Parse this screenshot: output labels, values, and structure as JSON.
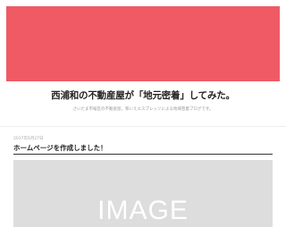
{
  "header": {
    "hero_color": "#ef5a65",
    "site_title": "西浦和の不動産屋が「地元密着」してみた。",
    "site_description": "さいたま市桜区の不動産屋。和いえエスプレッソによる地域密着ブログです。"
  },
  "post": {
    "date": "2017年6月27日",
    "title": "ホームページを作成しました！",
    "thumbnail_label": "IMAGE"
  },
  "colors": {
    "background": "#ffffff",
    "thumbnail_bg": "#dddddd"
  }
}
